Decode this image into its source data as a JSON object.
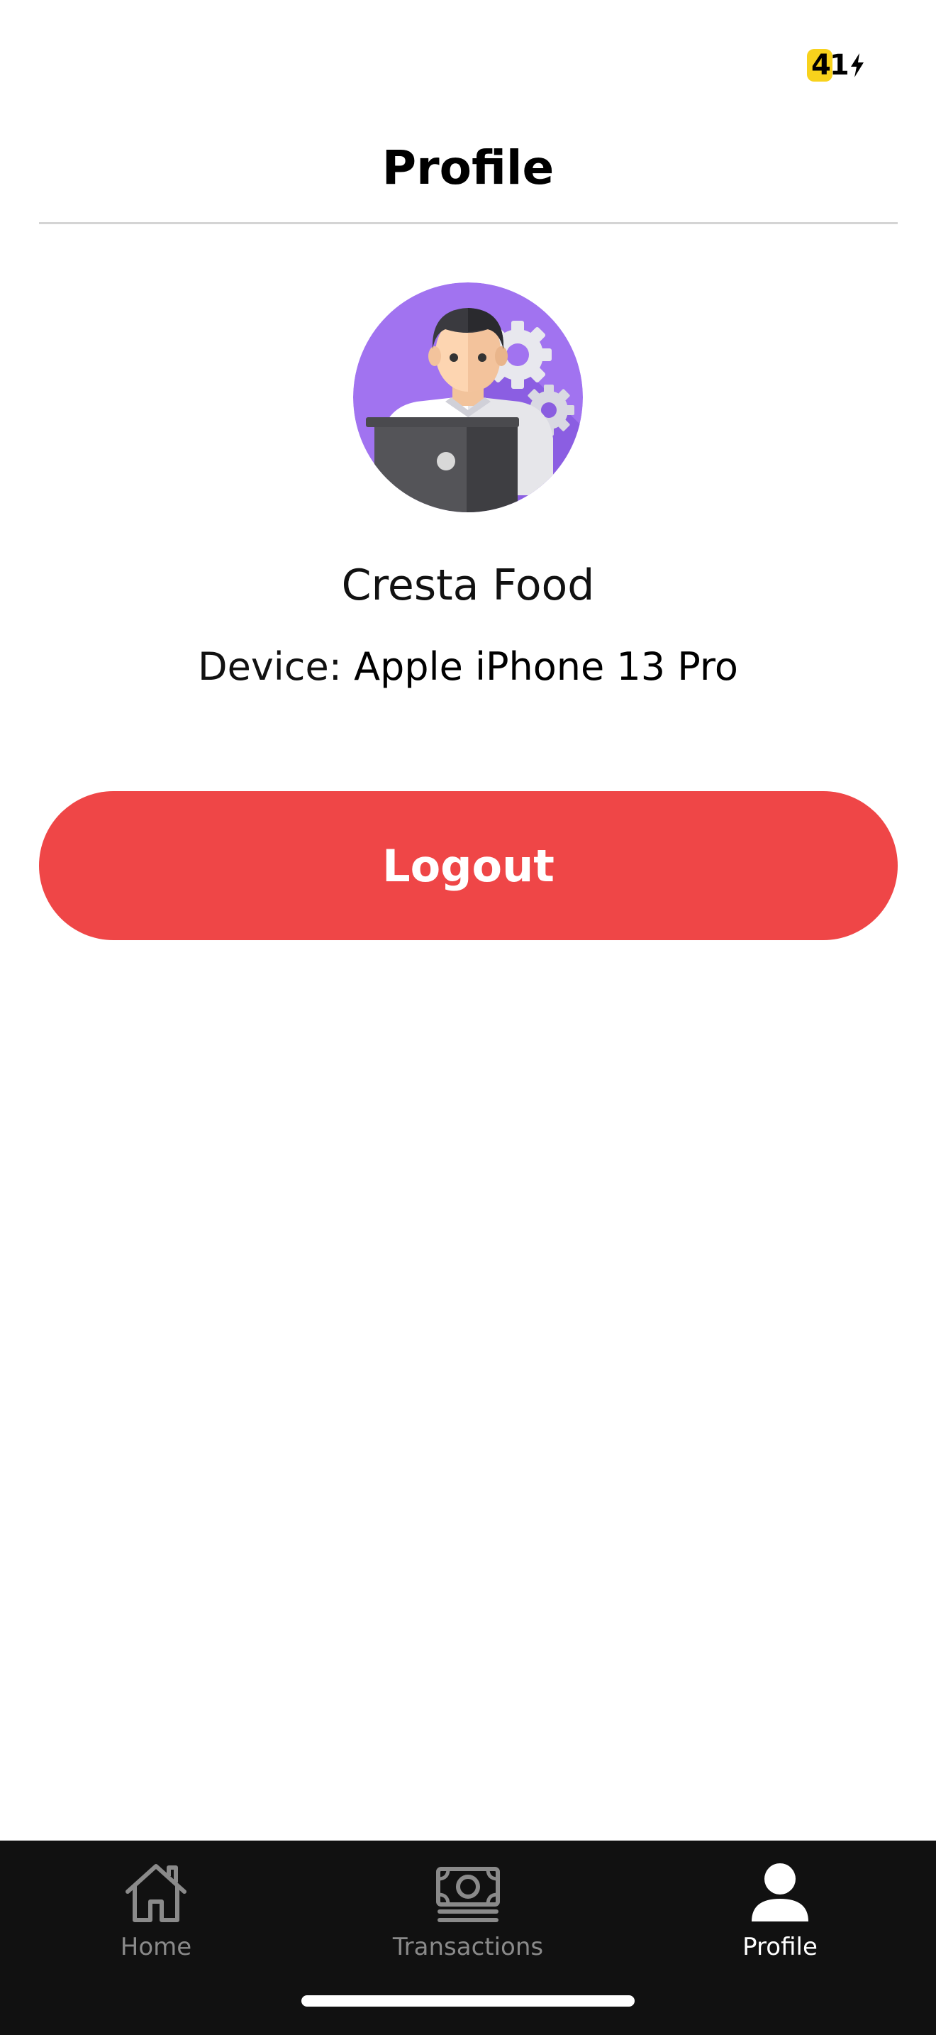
{
  "status_bar": {
    "battery_level": "41",
    "battery_icon": "charging-bolt-icon",
    "battery_badge_color": "#f8d21c"
  },
  "header": {
    "title": "Profile"
  },
  "profile": {
    "avatar_icon": "developer-avatar-icon",
    "name": "Cresta Food",
    "device_label": "Device:",
    "device_value": "Apple iPhone 13 Pro"
  },
  "actions": {
    "logout_label": "Logout",
    "logout_color": "#ef4647"
  },
  "bottom_nav": {
    "items": [
      {
        "label": "Home",
        "icon": "home-icon",
        "active": false
      },
      {
        "label": "Transactions",
        "icon": "banknote-icon",
        "active": false
      },
      {
        "label": "Profile",
        "icon": "person-icon",
        "active": true
      }
    ],
    "background": "#111111"
  }
}
